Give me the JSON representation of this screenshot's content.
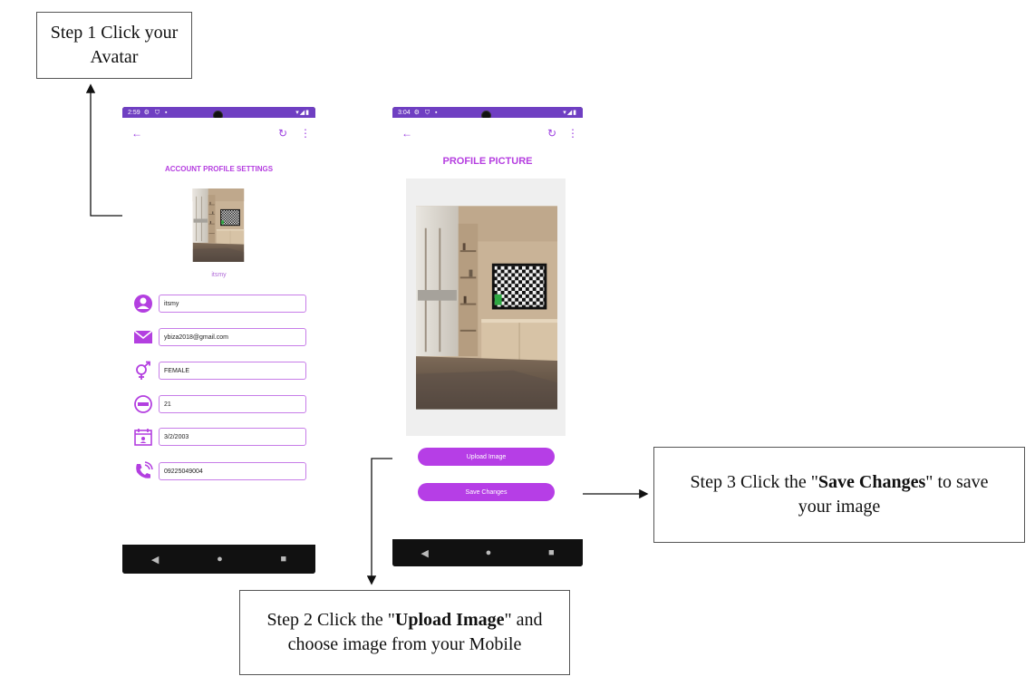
{
  "callouts": {
    "step1": {
      "line1": "Step 1 Click your",
      "line2": "Avatar"
    },
    "step2": {
      "before": "Step 2 Click the \"",
      "bold": "Upload Image",
      "after": "\" and",
      "line2": "choose image from your Mobile"
    },
    "step3": {
      "before": "Step 3 Click the \"",
      "bold": "Save Changes",
      "after": "\" to save",
      "line2": "your image"
    }
  },
  "phone1": {
    "time": "2:59",
    "title": "ACCOUNT PROFILE SETTINGS",
    "username_label": "itsmy",
    "fields": [
      {
        "icon": "person-icon",
        "value": "itsmy"
      },
      {
        "icon": "mail-icon",
        "value": "ybiza2018@gmail.com"
      },
      {
        "icon": "gender-icon",
        "value": "FEMALE"
      },
      {
        "icon": "age-icon",
        "value": "21"
      },
      {
        "icon": "calendar-icon",
        "value": "3/2/2003"
      },
      {
        "icon": "phone-icon",
        "value": "09225049004"
      }
    ]
  },
  "phone2": {
    "time": "3:04",
    "title": "PROFILE PICTURE",
    "upload_label": "Upload Image",
    "save_label": "Save Changes"
  },
  "colors": {
    "accent": "#b53ee0",
    "status_bar": "#6f3fc2"
  }
}
